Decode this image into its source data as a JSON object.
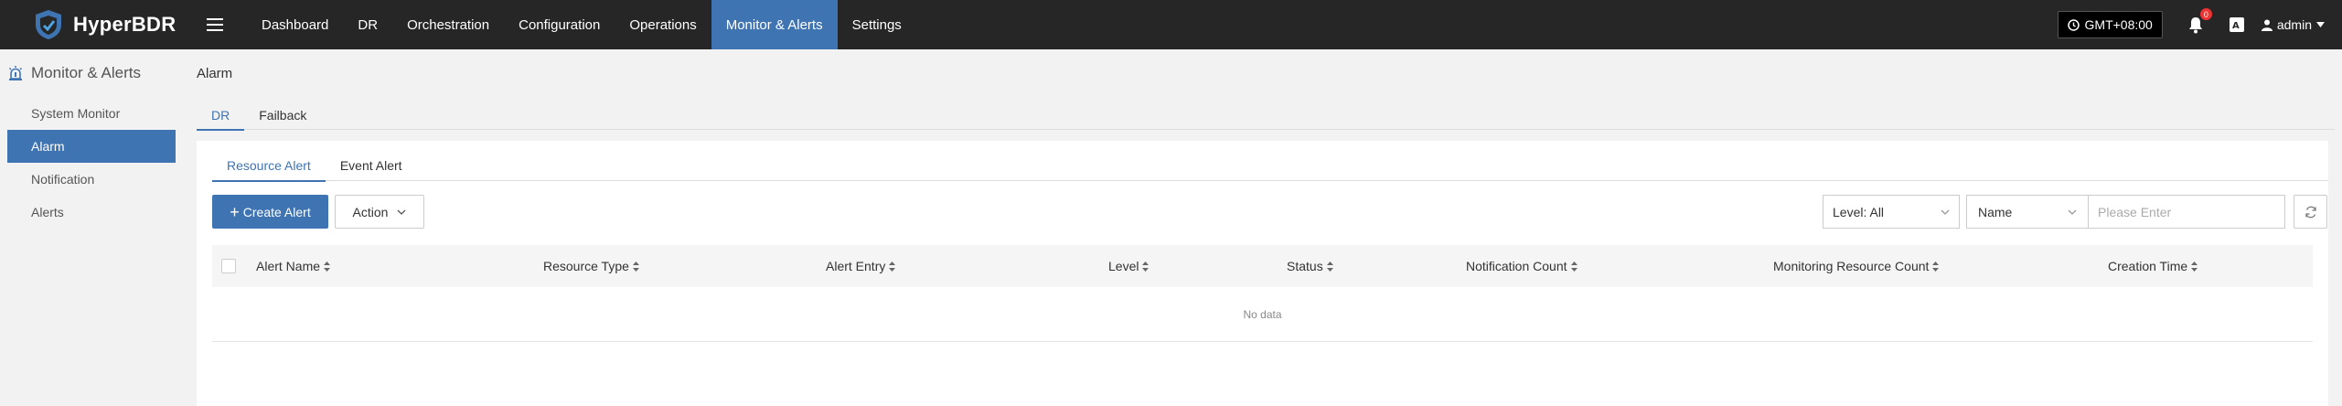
{
  "app": {
    "name": "HyperBDR"
  },
  "nav": {
    "items": [
      {
        "label": "Dashboard"
      },
      {
        "label": "DR"
      },
      {
        "label": "Orchestration"
      },
      {
        "label": "Configuration"
      },
      {
        "label": "Operations"
      },
      {
        "label": "Monitor & Alerts",
        "active": true
      },
      {
        "label": "Settings"
      }
    ]
  },
  "topright": {
    "timezone": "GMT+08:00",
    "notification_count": "0",
    "user": "admin"
  },
  "sidebar": {
    "title": "Monitor & Alerts",
    "items": [
      {
        "label": "System Monitor"
      },
      {
        "label": "Alarm",
        "active": true
      },
      {
        "label": "Notification"
      },
      {
        "label": "Alerts"
      }
    ]
  },
  "page": {
    "title": "Alarm",
    "tabs": [
      {
        "label": "DR",
        "active": true
      },
      {
        "label": "Failback"
      }
    ],
    "subtabs": [
      {
        "label": "Resource Alert",
        "active": true
      },
      {
        "label": "Event Alert"
      }
    ]
  },
  "toolbar": {
    "create_label": "Create Alert",
    "action_label": "Action",
    "level_filter": "Level: All",
    "name_filter": "Name",
    "search_placeholder": "Please Enter"
  },
  "table": {
    "columns": [
      "Alert Name",
      "Resource Type",
      "Alert Entry",
      "Level",
      "Status",
      "Notification Count",
      "Monitoring Resource Count",
      "Creation Time"
    ],
    "empty_text": "No data"
  },
  "colors": {
    "accent": "#3f74b3",
    "topbar": "#262626"
  }
}
